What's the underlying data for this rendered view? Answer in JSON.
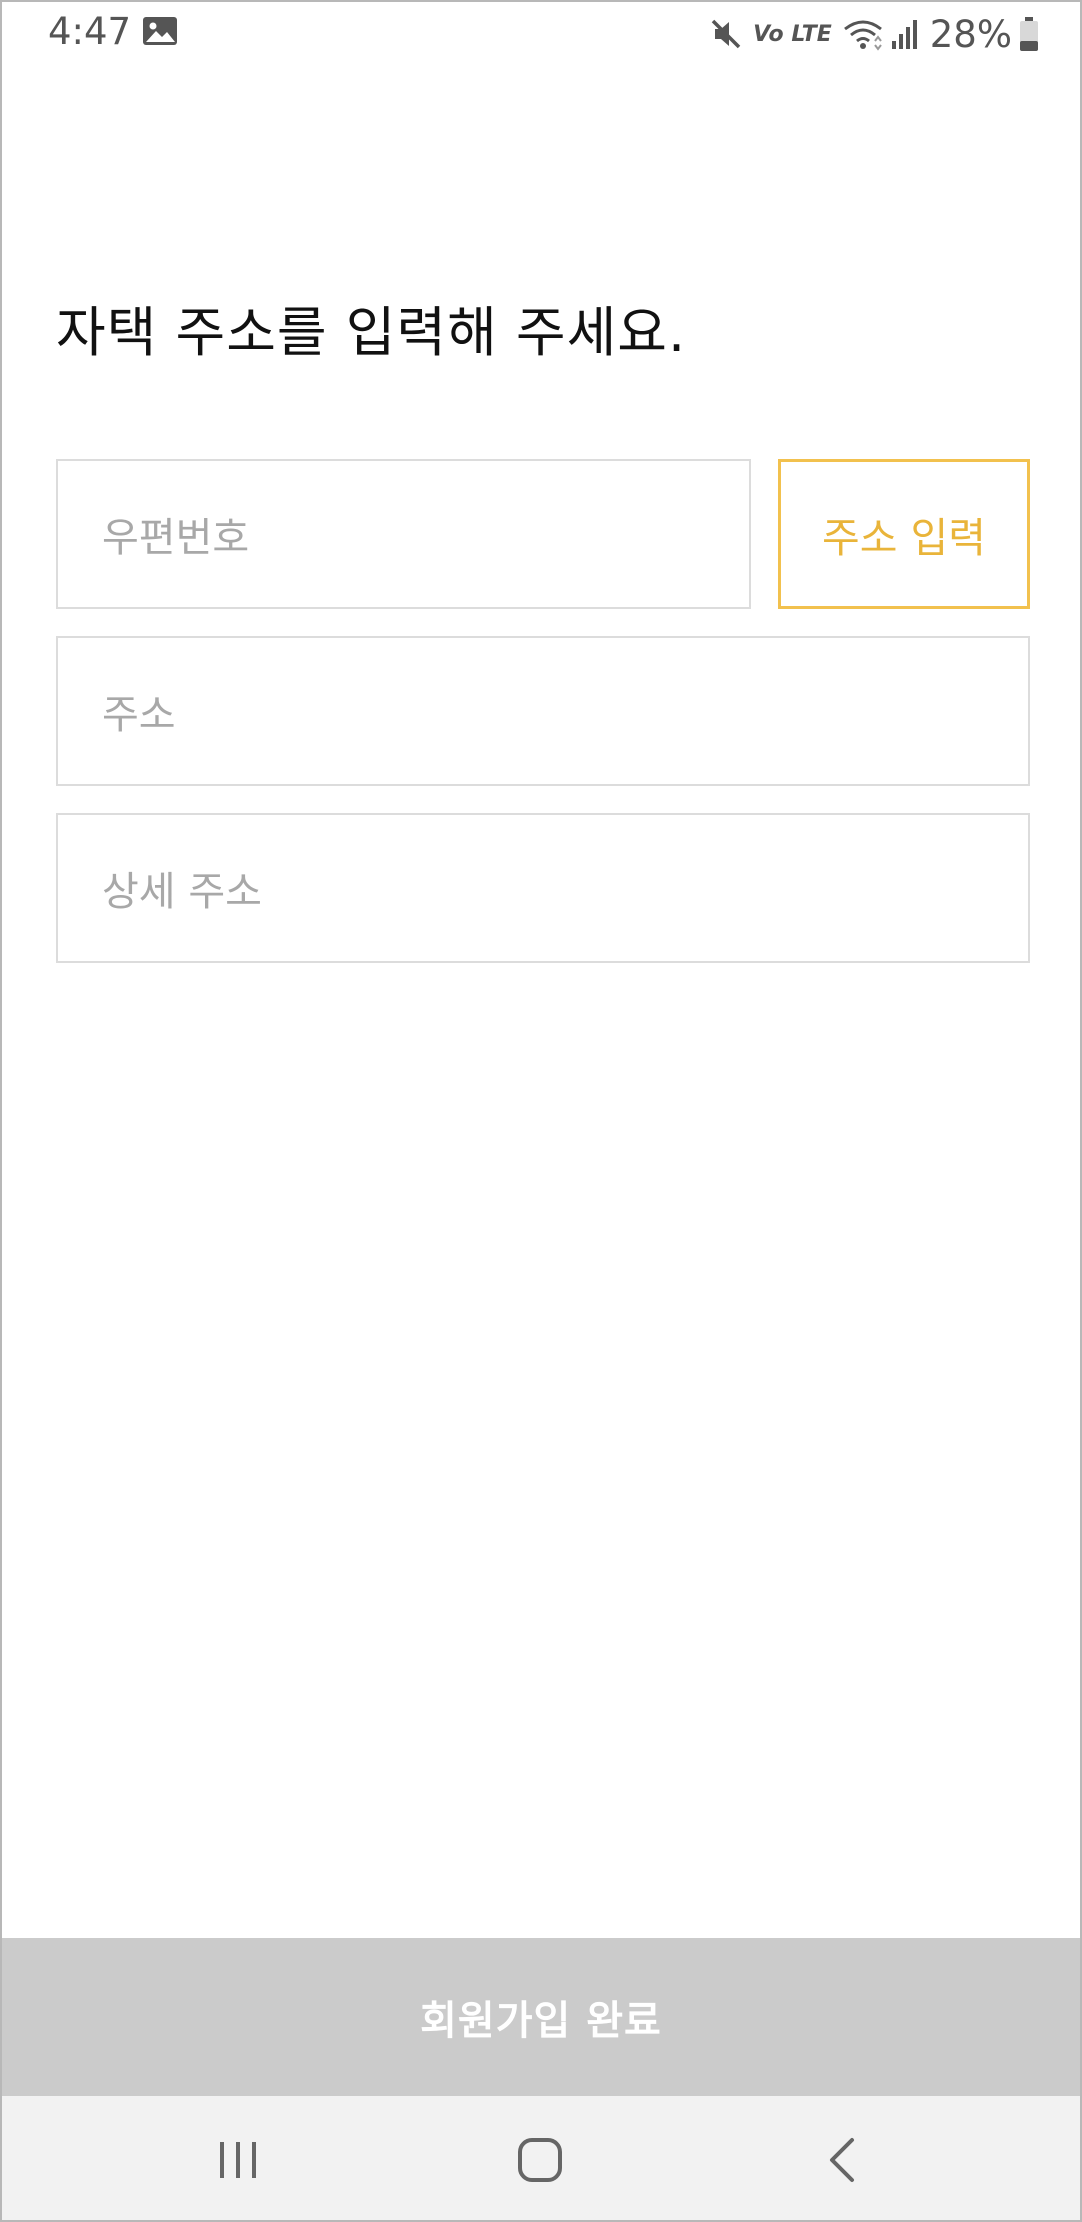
{
  "status_bar": {
    "time": "4:47",
    "network_label": "Vo LTE",
    "battery_percent": "28%",
    "icons": [
      "gallery-icon",
      "mute-icon",
      "wifi-icon",
      "signal-icon",
      "battery-icon"
    ]
  },
  "form": {
    "headline": "자택 주소를 입력해 주세요.",
    "zip_placeholder": "우편번호",
    "address_button_label": "주소 입력",
    "address_placeholder": "주소",
    "detail_placeholder": "상세 주소"
  },
  "footer": {
    "complete_label": "회원가입 완료"
  },
  "navigation": {
    "icons": [
      "recents-icon",
      "home-icon",
      "back-icon"
    ]
  },
  "colors": {
    "accent": "#f2c14e",
    "accent_text": "#e9b43a",
    "field_border": "#dcdcdc",
    "placeholder_text": "#a8a8a8",
    "disabled_button": "#cbcbcb",
    "nav_bar": "#f2f2f2"
  }
}
